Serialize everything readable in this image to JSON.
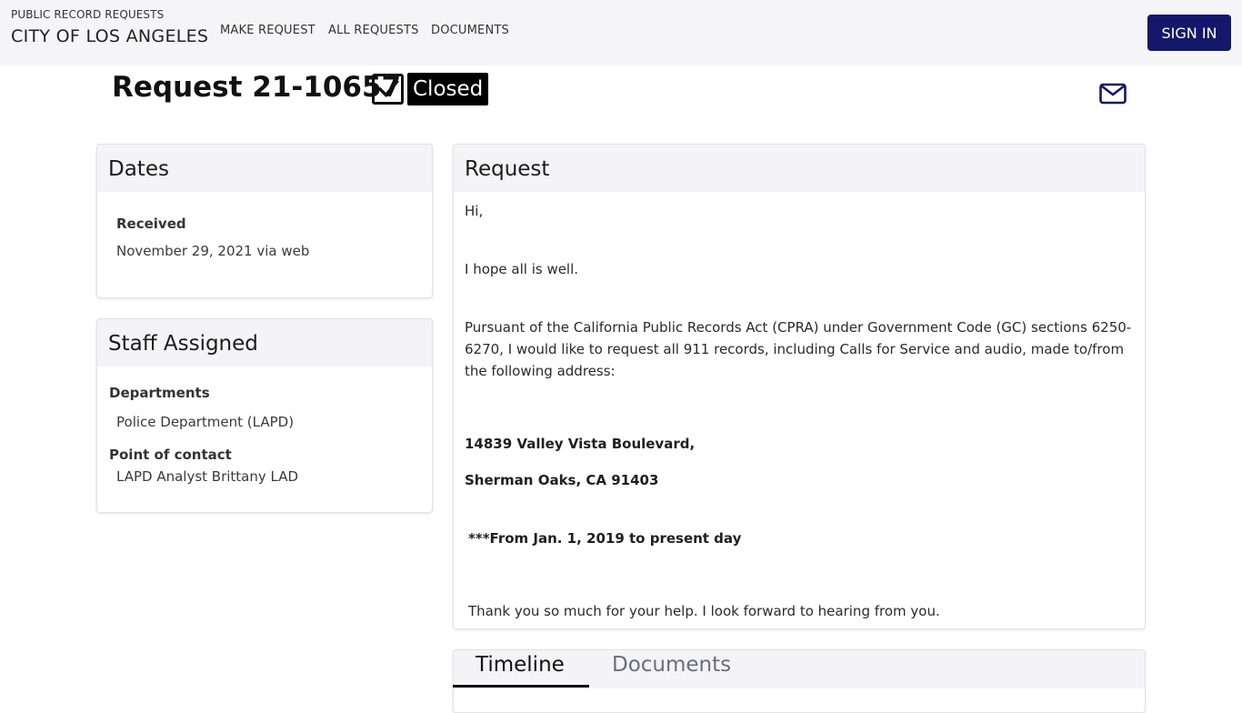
{
  "header": {
    "subtitle": "PUBLIC RECORD REQUESTS",
    "title": "CITY OF LOS ANGELES",
    "nav": [
      "MAKE REQUEST",
      "ALL REQUESTS",
      "DOCUMENTS"
    ],
    "signin_label": "SIGN IN",
    "brand_color": "#15186a"
  },
  "request": {
    "title": "Request 21-10657",
    "status": "Closed",
    "status_icon": "checkbox-checked-icon",
    "mail_icon": "envelope-icon"
  },
  "dates": {
    "heading": "Dates",
    "received_label": "Received",
    "received_value": "November 29, 2021 via web"
  },
  "staff": {
    "heading": "Staff Assigned",
    "departments_label": "Departments",
    "departments_value": "Police Department (LAPD)",
    "contact_label": "Point of contact",
    "contact_value": "LAPD Analyst Brittany LAD"
  },
  "request_card": {
    "heading": "Request",
    "greeting": "Hi,",
    "line_hope": "I hope all is well.",
    "paragraph_line1": "Pursuant of the California Public Records Act (CPRA) under Government Code (GC) sections 6250-",
    "paragraph_line2": "6270, I would like to request all 911 records, including Calls for Service and audio, made to/from",
    "paragraph_line3": "the following address:",
    "address_line1": "14839 Valley Vista Boulevard,",
    "address_line2": "Sherman Oaks, CA 91403",
    "date_range": "***From Jan. 1, 2019 to present day",
    "closing": "Thank you so much for your help. I look forward to hearing from you."
  },
  "tabs": {
    "timeline": "Timeline",
    "documents": "Documents",
    "active": "Timeline"
  }
}
